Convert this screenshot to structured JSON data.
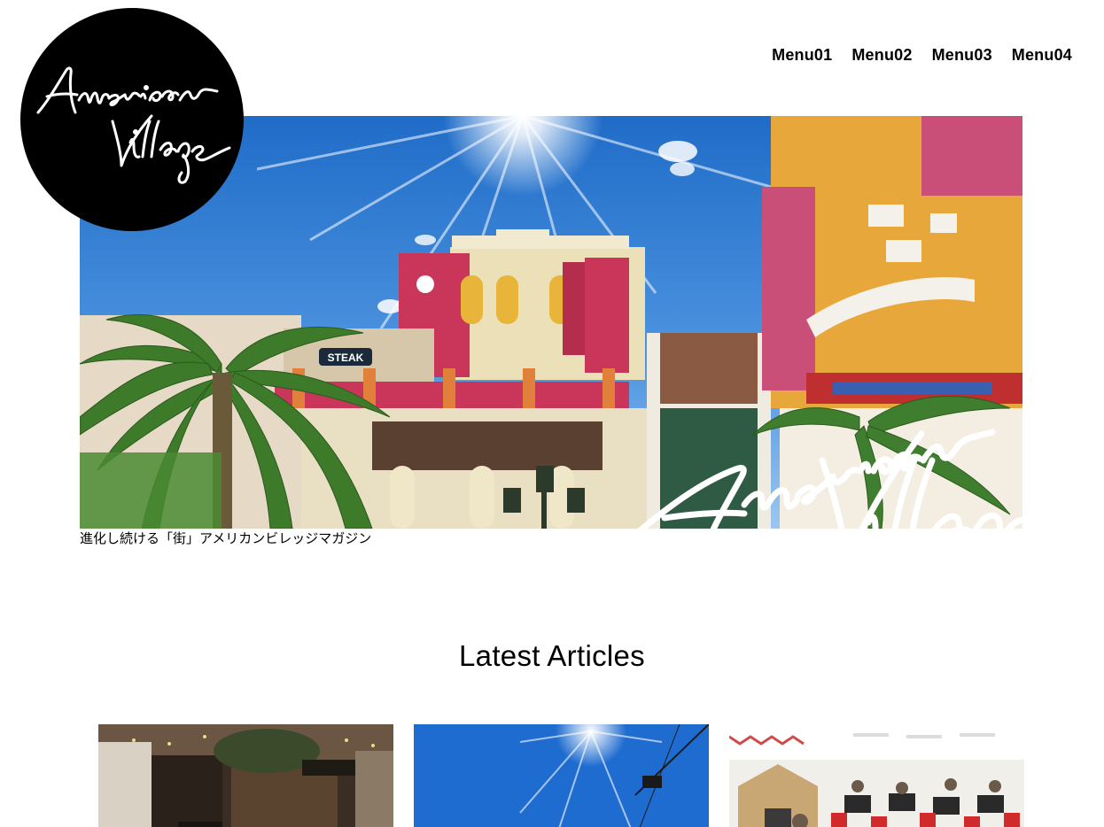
{
  "header": {
    "logo_text": "American Village",
    "nav": [
      {
        "label": "Menu01"
      },
      {
        "label": "Menu02"
      },
      {
        "label": "Menu03"
      },
      {
        "label": "Menu04"
      }
    ]
  },
  "hero": {
    "tagline": "進化し続ける「街」アメリカンビレッジマガジン",
    "overlay_script_text": "American Village",
    "sign_text": "STEAK"
  },
  "articles": {
    "title": "Latest Articles",
    "cards": [
      {
        "image": "cafe-interior-photo"
      },
      {
        "image": "blue-sky-sun-photo"
      },
      {
        "image": "office-room-photo"
      }
    ]
  },
  "colors": {
    "sky": "#2f7fd6",
    "pink": "#c9365a",
    "yellow": "#e8b43a",
    "palm": "#3d7a2a"
  }
}
